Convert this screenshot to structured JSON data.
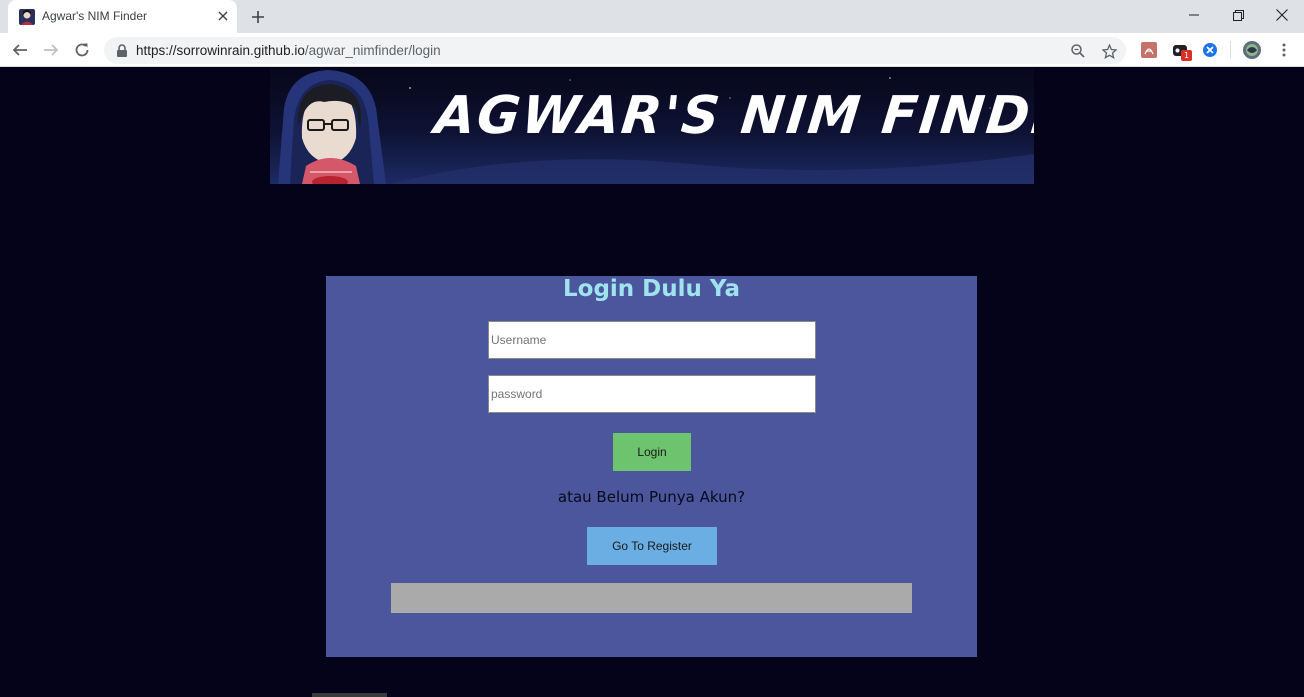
{
  "browser": {
    "tab_title": "Agwar's NIM Finder",
    "url_host": "https://sorrowinrain.github.io",
    "url_path": "/agwar_nimfinder/login",
    "extension_badge": "1"
  },
  "banner": {
    "title": "AGWAR'S NIM FINDER"
  },
  "login": {
    "title": "Login Dulu Ya",
    "username_placeholder": "Username",
    "password_placeholder": "password",
    "login_label": "Login",
    "alt_text": "atau Belum Punya Akun?",
    "register_label": "Go To Register"
  },
  "colors": {
    "page_bg": "#04031a",
    "card_bg": "#4c569c",
    "title_color": "#9ee3ee",
    "login_button": "#6ec46e",
    "register_button": "#6aaee3",
    "message_bar": "#aaaaaa"
  },
  "icons": [
    "favicon-icon",
    "close-icon",
    "plus-icon",
    "minimize-icon",
    "restore-icon",
    "window-close-icon",
    "back-arrow-icon",
    "forward-arrow-icon",
    "reload-icon",
    "lock-icon",
    "zoom-icon",
    "star-icon",
    "pdf-extension-icon",
    "extension-icon",
    "extension-icon-blue",
    "profile-avatar-icon",
    "menu-dots-icon"
  ]
}
